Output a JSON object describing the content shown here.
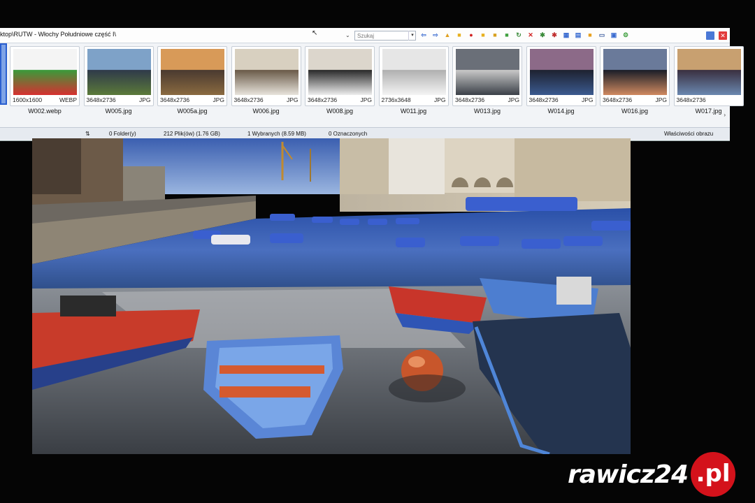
{
  "window": {
    "path": "ktop\\RUTW - Włochy Południowe część I\\",
    "search_placeholder": "Szukaj"
  },
  "colors": {
    "accent": "#2a5fd0",
    "close": "#e23b3b",
    "brand_red": "#d4121b"
  },
  "toolbar_icons": [
    {
      "name": "back-arrow-icon",
      "glyph": "⇦",
      "color": "#3a6bd0"
    },
    {
      "name": "forward-arrow-icon",
      "glyph": "⇨",
      "color": "#3a6bd0"
    },
    {
      "name": "folder-up-icon",
      "glyph": "▲",
      "color": "#e0a020"
    },
    {
      "name": "folder-icon",
      "glyph": "■",
      "color": "#e8b020"
    },
    {
      "name": "record-icon",
      "glyph": "●",
      "color": "#d02020"
    },
    {
      "name": "folder-open-icon",
      "glyph": "■",
      "color": "#e8b020"
    },
    {
      "name": "copy-icon",
      "glyph": "■",
      "color": "#d8a020"
    },
    {
      "name": "move-icon",
      "glyph": "■",
      "color": "#40a040"
    },
    {
      "name": "refresh-icon",
      "glyph": "↻",
      "color": "#3a8a3a"
    },
    {
      "name": "delete-icon",
      "glyph": "✕",
      "color": "#d02020"
    },
    {
      "name": "tools-icon",
      "glyph": "✱",
      "color": "#3a8a3a"
    },
    {
      "name": "effects-icon",
      "glyph": "✱",
      "color": "#c03030"
    },
    {
      "name": "grid-view-icon",
      "glyph": "▦",
      "color": "#3a6bd0"
    },
    {
      "name": "list-view-icon",
      "glyph": "▤",
      "color": "#3a6bd0"
    },
    {
      "name": "stop-icon",
      "glyph": "■",
      "color": "#e8a020"
    },
    {
      "name": "print-icon",
      "glyph": "▭",
      "color": "#4060a0"
    },
    {
      "name": "slideshow-icon",
      "glyph": "▣",
      "color": "#3a6bd0"
    },
    {
      "name": "settings-icon",
      "glyph": "⚙",
      "color": "#40a040"
    }
  ],
  "thumbnails": [
    {
      "name": "W002.webp",
      "dims": "1600x1600",
      "type": "WEBP"
    },
    {
      "name": "W005.jpg",
      "dims": "3648x2736",
      "type": "JPG"
    },
    {
      "name": "W005a.jpg",
      "dims": "3648x2736",
      "type": "JPG"
    },
    {
      "name": "W006.jpg",
      "dims": "3648x2736",
      "type": "JPG"
    },
    {
      "name": "W008.jpg",
      "dims": "3648x2736",
      "type": "JPG"
    },
    {
      "name": "W011.jpg",
      "dims": "2736x3648",
      "type": "JPG"
    },
    {
      "name": "W013.jpg",
      "dims": "3648x2736",
      "type": "JPG"
    },
    {
      "name": "W014.jpg",
      "dims": "3648x2736",
      "type": "JPG"
    },
    {
      "name": "W016.jpg",
      "dims": "3648x2736",
      "type": "JPG"
    },
    {
      "name": "W017.jpg",
      "dims": "3648x2736",
      "type": ""
    }
  ],
  "status": {
    "folders": "0 Folder(y)",
    "files": "212 Plik(ów) (1.76 GB)",
    "selected": "1 Wybranych (8.59 MB)",
    "marked": "0 Oznaczonych",
    "properties": "Właściwości obrazu"
  },
  "watermark": {
    "text": "rawicz24",
    "badge": ".pl"
  }
}
